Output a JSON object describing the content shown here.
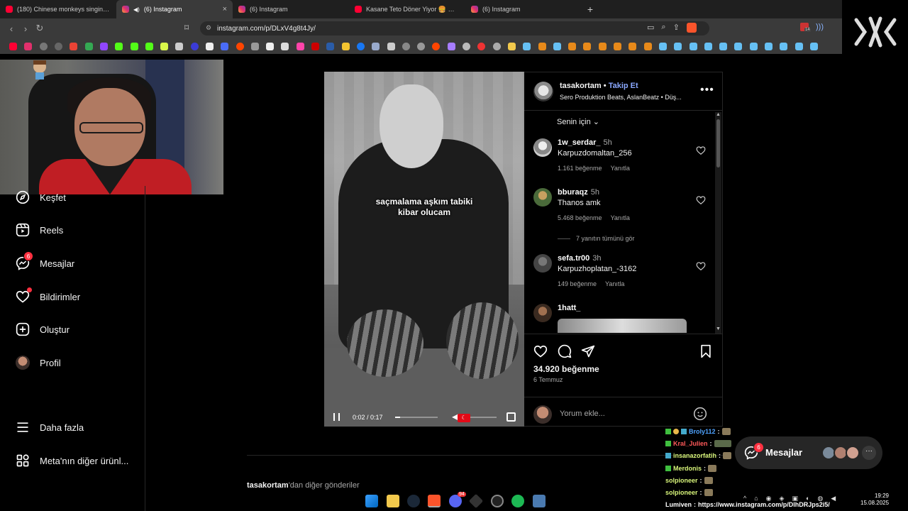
{
  "browser": {
    "tabs": [
      {
        "label": "(180) Chinese monkeys singing (Engl",
        "icon": "youtube-icon",
        "active": false
      },
      {
        "label": "(6) Instagram",
        "icon": "instagram-icon",
        "active": true
      },
      {
        "label": "(6) Instagram",
        "icon": "instagram-icon",
        "active": false
      },
      {
        "label": "Kasane Teto Döner Yiyor 🍔 🟥 🍗 .c",
        "icon": "youtube-icon",
        "active": false
      },
      {
        "label": "(6) Instagram",
        "icon": "instagram-icon",
        "active": false
      }
    ],
    "new_tab": "+",
    "close_tab": "×",
    "url": "instagram.com/p/DLxV4g8t4Jy/",
    "extension_badge": "14"
  },
  "sidebar": {
    "items": [
      {
        "label": "Keşfet",
        "icon": "compass-icon"
      },
      {
        "label": "Reels",
        "icon": "reels-icon"
      },
      {
        "label": "Mesajlar",
        "icon": "messenger-icon",
        "badge": "6"
      },
      {
        "label": "Bildirimler",
        "icon": "heart-icon"
      },
      {
        "label": "Oluştur",
        "icon": "plus-square-icon"
      },
      {
        "label": "Profil",
        "icon": "profile-avatar"
      },
      {
        "label": "Daha fazla",
        "icon": "menu-icon"
      },
      {
        "label": "Meta'nın diğer ürünl...",
        "icon": "grid-icon"
      }
    ]
  },
  "video": {
    "caption_line1": "saçmalama aşkım tabiki",
    "caption_line2": "kibar olucam",
    "time": "0:02 / 0:17",
    "progress": 0.12
  },
  "post": {
    "username": "tasakortam",
    "separator": "•",
    "follow": "Takip Et",
    "audio": "Sero Produktion Beats, AslanBeatz • Düş...",
    "more": "•••",
    "sort": "Senin için",
    "comments": [
      {
        "user": "1w_serdar_",
        "time": "5h",
        "text": "Karpuzdomaltan_256",
        "likes": "1.161 beğenme",
        "reply": "Yanıtla"
      },
      {
        "user": "bburaqz",
        "time": "5h",
        "text": "Thanos amk",
        "likes": "5.468 beğenme",
        "reply": "Yanıtla"
      },
      {
        "user": "sefa.tr00",
        "time": "3h",
        "text": "Karpuzhoplatan_-3162",
        "likes": "149 beğenme",
        "reply": "Yanıtla"
      },
      {
        "user": "1hatt_",
        "time": "",
        "text": "",
        "likes": "",
        "reply": ""
      }
    ],
    "view_replies": "7 yanıtın tümünü gör",
    "like_count": "34.920 beğenme",
    "date": "6 Temmuz",
    "comment_placeholder": "Yorum ekle..."
  },
  "more_posts": {
    "user": "tasakortam",
    "suffix": "'dan diğer gönderiler"
  },
  "chat": [
    {
      "user": "Broly112",
      "color": "#4fa3ff"
    },
    {
      "user": "Kral_Julien",
      "color": "#ff5a5a"
    },
    {
      "user": "insanazorfatih",
      "color": "#d8f57a"
    },
    {
      "user": "Merdonis",
      "color": "#d8f57a"
    },
    {
      "user": "solpioneer",
      "color": "#d8f57a"
    },
    {
      "user": "solpioneer",
      "color": "#d8f57a"
    },
    {
      "user": "Lumiven",
      "color": "#ffffff",
      "message": "https://www.instagram.com/p/DlhDRJps2i5/"
    }
  ],
  "chat_sep": ":",
  "messages_pill": {
    "label": "Mesajlar",
    "badge": "6",
    "more": "···"
  },
  "taskbar": {
    "time": "19:29",
    "date": "15.08.2025",
    "discord_badge": "94"
  },
  "colors": {
    "accent": "#0095f6",
    "follow": "#8aa8ff",
    "badge": "#ff3040"
  }
}
